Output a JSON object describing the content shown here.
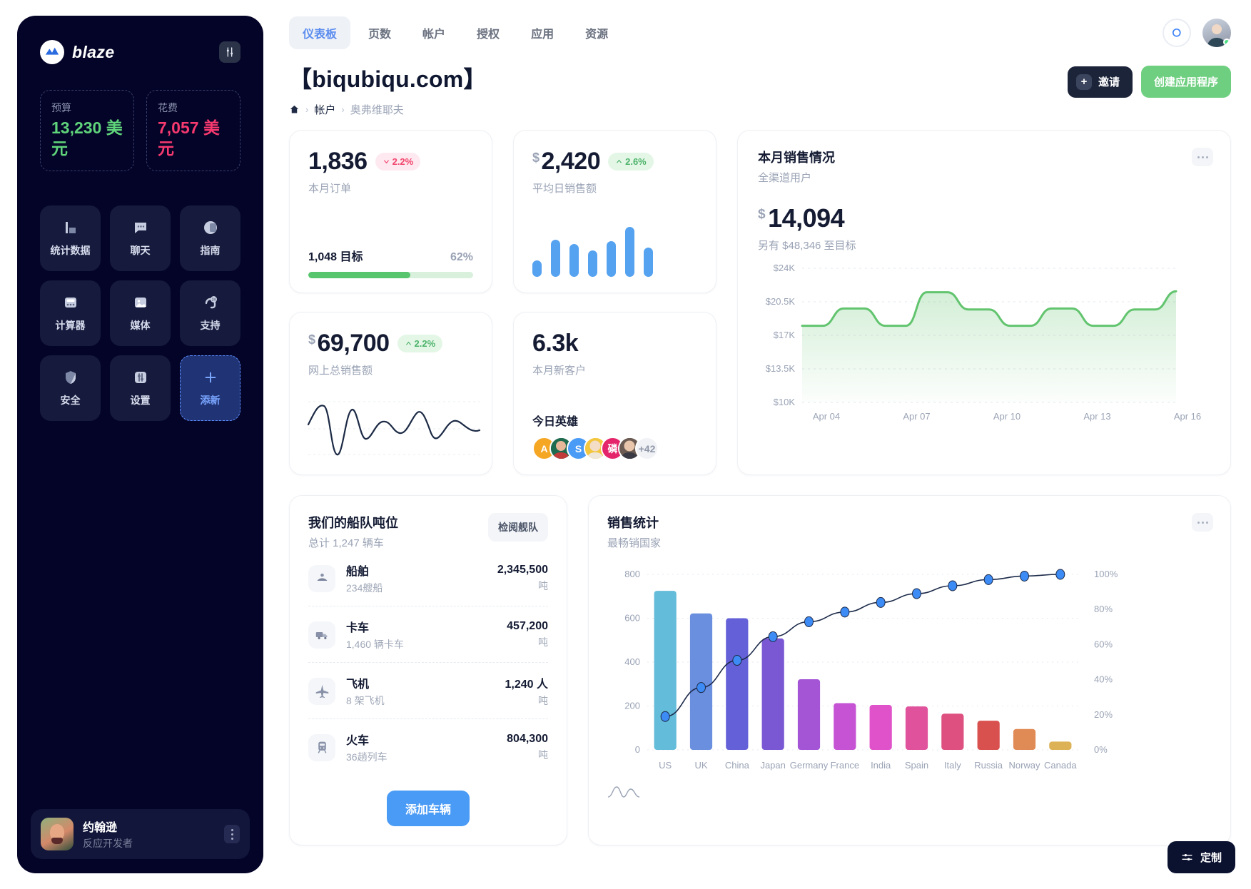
{
  "sidebar": {
    "brand": "blaze",
    "tool_icon": "sliders-icon",
    "budget": {
      "label": "预算",
      "value": "13,230 美元"
    },
    "spend": {
      "label": "花费",
      "value": "7,057 美元"
    },
    "nav": [
      {
        "label": "统计数据",
        "icon": "bar-chart-icon"
      },
      {
        "label": "聊天",
        "icon": "chat-bubble-icon"
      },
      {
        "label": "指南",
        "icon": "book-guide-icon"
      },
      {
        "label": "计算器",
        "icon": "calculator-icon"
      },
      {
        "label": "媒体",
        "icon": "image-media-icon"
      },
      {
        "label": "支持",
        "icon": "support-24-icon"
      },
      {
        "label": "安全",
        "icon": "shield-icon"
      },
      {
        "label": "设置",
        "icon": "settings-sliders-icon"
      },
      {
        "label": "添新",
        "icon": "plus-icon"
      }
    ],
    "user": {
      "name": "约翰逊",
      "role": "反应开发者"
    }
  },
  "header": {
    "tabs": [
      "仪表板",
      "页数",
      "帐户",
      "授权",
      "应用",
      "资源"
    ],
    "active_tab": "仪表板",
    "title": "【biqubiqu.com】",
    "breadcrumb": [
      "帐户",
      "奥弗维耶夫"
    ],
    "invite_label": "邀请",
    "create_label": "创建应用程序"
  },
  "kpis": {
    "orders": {
      "value": "1,836",
      "currency": "",
      "delta": "2.2%",
      "dir": "down",
      "label": "本月订单",
      "goal_label": "1,048 目标",
      "goal_pct": "62%",
      "progress": 62
    },
    "avg_sale": {
      "value": "2,420",
      "currency": "$",
      "delta": "2.6%",
      "dir": "up",
      "label": "平均日销售额"
    },
    "online": {
      "value": "69,700",
      "currency": "$",
      "delta": "2.2%",
      "dir": "up",
      "label": "网上总销售额"
    },
    "customers": {
      "value": "6.3k",
      "currency": "",
      "label": "本月新客户",
      "heroes_label": "今日英雄",
      "heroes_more": "+42",
      "heroes": [
        "A",
        "",
        "S",
        "",
        "磷",
        ""
      ]
    }
  },
  "month_sales": {
    "title": "本月销售情况",
    "subtitle": "全渠道用户",
    "currency": "$",
    "value": "14,094",
    "note": "另有 $48,346 至目标"
  },
  "fleet": {
    "title": "我们的船队吨位",
    "subtitle": "总计 1,247 辆车",
    "review_label": "检阅舰队",
    "add_label": "添加车辆",
    "rows": [
      {
        "name": "船舶",
        "meta": "234艘船",
        "amount": "2,345,500",
        "unit": "吨",
        "icon": "ship-icon"
      },
      {
        "name": "卡车",
        "meta": "1,460 辆卡车",
        "amount": "457,200",
        "unit": "吨",
        "icon": "truck-icon"
      },
      {
        "name": "飞机",
        "meta": "8 架飞机",
        "amount": "1,240 人",
        "unit": "吨",
        "icon": "plane-icon"
      },
      {
        "name": "火车",
        "meta": "36趟列车",
        "amount": "804,300",
        "unit": "吨",
        "icon": "train-icon"
      }
    ]
  },
  "chart_data": [
    {
      "type": "area",
      "id": "month-sales-area",
      "title": "本月销售情况",
      "subtitle": "全渠道用户",
      "xlabel": "",
      "ylabel": "",
      "ylim": [
        10000,
        24000
      ],
      "ytick_labels": [
        "$24K",
        "$20.5K",
        "$17K",
        "$13.5K",
        "$10K"
      ],
      "ytick_values": [
        24000,
        20500,
        17000,
        13500,
        10000
      ],
      "xtick_labels": [
        "Apr 04",
        "Apr 07",
        "Apr 10",
        "Apr 13",
        "Apr 16"
      ],
      "grid": true,
      "line_color": "#62c46e",
      "values": [
        18000,
        18000,
        19800,
        19800,
        18000,
        18000,
        21500,
        21500,
        19700,
        19700,
        18000,
        18000,
        19800,
        19800,
        18000,
        18000,
        19700,
        19700,
        21600
      ]
    },
    {
      "type": "bar",
      "id": "sales-statistics-pareto",
      "title": "销售统计",
      "subtitle": "最畅销国家",
      "categories": [
        "US",
        "UK",
        "China",
        "Japan",
        "Germany",
        "France",
        "India",
        "Spain",
        "Italy",
        "Russia",
        "Norway",
        "Canada"
      ],
      "values": [
        725,
        622,
        600,
        508,
        322,
        213,
        205,
        198,
        165,
        133,
        95,
        38
      ],
      "ylim": [
        0,
        800
      ],
      "ytick_labels": [
        "800",
        "600",
        "400",
        "200",
        "0"
      ],
      "ytick_values": [
        800,
        600,
        400,
        200,
        0
      ],
      "bar_colors": [
        "#63bcd9",
        "#6b8fdf",
        "#6460d8",
        "#7a58d4",
        "#a355d6",
        "#c553d4",
        "#e052c9",
        "#e0529c",
        "#dd5080",
        "#d9514f",
        "#e08a55",
        "#ddb257"
      ],
      "series": [
        {
          "name": "cumulative-percent",
          "type": "line",
          "axis": "right",
          "values": [
            19,
            35.5,
            51,
            64.5,
            73,
            78.5,
            84,
            89,
            93.5,
            97,
            99,
            100
          ],
          "point_color": "#3d8bf5",
          "line_color": "#1d2b4a"
        }
      ],
      "right_axis": {
        "ytick_labels": [
          "100%",
          "80%",
          "60%",
          "40%",
          "20%",
          "0%"
        ],
        "ylim": [
          0,
          100
        ]
      },
      "grid": true
    }
  ],
  "stats_card": {
    "title": "销售统计",
    "subtitle": "最畅销国家"
  },
  "customize": {
    "label": "定制",
    "icon": "sliders-icon"
  }
}
